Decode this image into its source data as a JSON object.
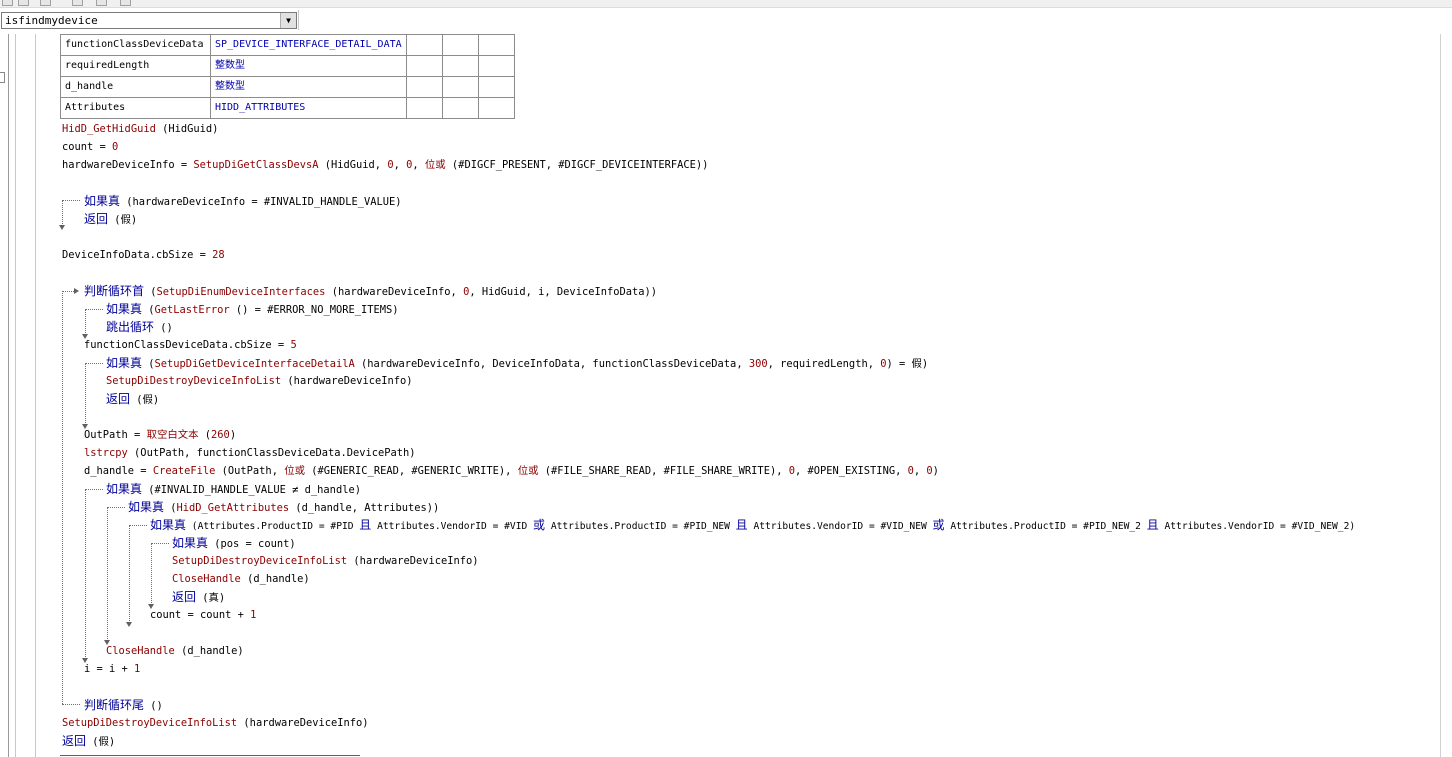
{
  "selector": {
    "value": "isfindmydevice"
  },
  "var_table": [
    {
      "name": "functionClassDeviceData",
      "type": "SP_DEVICE_INTERFACE_DETAIL_DATA"
    },
    {
      "name": "requiredLength",
      "type": "整数型"
    },
    {
      "name": "d_handle",
      "type": "整数型"
    },
    {
      "name": "Attributes",
      "type": "HIDD_ATTRIBUTES"
    }
  ],
  "code": {
    "l1": {
      "fn": "HidD_GetHidGuid",
      "rest": " (HidGuid)"
    },
    "l2": {
      "a": "count = ",
      "n": "0"
    },
    "l3": {
      "a": "hardwareDeviceInfo = ",
      "fn": "SetupDiGetClassDevsA",
      "b": " (HidGuid, ",
      "n1": "0",
      "c": ", ",
      "n2": "0",
      "d": ", ",
      "kw": "位或",
      "e": " (#DIGCF_PRESENT, #DIGCF_DEVICEINTERFACE))"
    },
    "l4": {
      "kw": "如果真",
      "rest": " (hardwareDeviceInfo = #INVALID_HANDLE_VALUE)"
    },
    "l5": {
      "kw": "返回",
      "rest": " (假)"
    },
    "l6": {
      "a": "DeviceInfoData.cbSize = ",
      "n": "28"
    },
    "l7": {
      "kw": "判断循环首",
      "b": " (",
      "fn": "SetupDiEnumDeviceInterfaces",
      "c": " (hardwareDeviceInfo, ",
      "n": "0",
      "d": ", HidGuid, i, DeviceInfoData))"
    },
    "l8": {
      "kw": "如果真",
      "b": " (",
      "fn": "GetLastError",
      "c": " () = #ERROR_NO_MORE_ITEMS)"
    },
    "l9": {
      "kw": "跳出循环",
      "rest": " ()"
    },
    "l10": {
      "a": "functionClassDeviceData.cbSize = ",
      "n": "5"
    },
    "l11": {
      "kw": "如果真",
      "b": " (",
      "fn": "SetupDiGetDeviceInterfaceDetailA",
      "c": " (hardwareDeviceInfo, DeviceInfoData, functionClassDeviceData, ",
      "n": "300",
      "d": ", requiredLength, ",
      "n2": "0",
      "e": ") = 假)"
    },
    "l12": {
      "fn": "SetupDiDestroyDeviceInfoList",
      "rest": " (hardwareDeviceInfo)"
    },
    "l13": {
      "kw": "返回",
      "rest": " (假)"
    },
    "l14": {
      "a": "OutPath = ",
      "kw": "取空白文本",
      "b": " (",
      "n": "260",
      "c": ")"
    },
    "l15": {
      "fn": "lstrcpy",
      "rest": " (OutPath, functionClassDeviceData.DevicePath)"
    },
    "l16": {
      "a": "d_handle = ",
      "fn": "CreateFile",
      "b": " (OutPath, ",
      "kw1": "位或",
      "c": " (#GENERIC_READ, #GENERIC_WRITE), ",
      "kw2": "位或",
      "d": " (#FILE_SHARE_READ, #FILE_SHARE_WRITE), ",
      "n1": "0",
      "e": ", #OPEN_EXISTING, ",
      "n2": "0",
      "f": ", ",
      "n3": "0",
      "g": ")"
    },
    "l17": {
      "kw": "如果真",
      "rest": " (#INVALID_HANDLE_VALUE ≠ d_handle)"
    },
    "l18": {
      "kw": "如果真",
      "b": " (",
      "fn": "HidD_GetAttributes",
      "c": " (d_handle, Attributes))"
    },
    "l19": {
      "kw": "如果真",
      "a": " (Attributes.ProductID = #PID ",
      "k2": "且",
      "b": " Attributes.VendorID = #VID ",
      "k3": "或",
      "c": " Attributes.ProductID = #PID_NEW ",
      "k4": "且",
      "d": " Attributes.VendorID = #VID_NEW ",
      "k5": "或",
      "e": " Attributes.ProductID = #PID_NEW_2 ",
      "k6": "且",
      "f": " Attributes.VendorID = #VID_NEW_2)"
    },
    "l20": {
      "kw": "如果真",
      "rest": " (pos = count)"
    },
    "l21": {
      "fn": "SetupDiDestroyDeviceInfoList",
      "rest": " (hardwareDeviceInfo)"
    },
    "l22": {
      "fn": "CloseHandle",
      "rest": " (d_handle)"
    },
    "l23": {
      "kw": "返回",
      "rest": " (真)"
    },
    "l24": {
      "a": "count = count + ",
      "n": "1"
    },
    "l25": {
      "fn": "CloseHandle",
      "rest": " (d_handle)"
    },
    "l26": {
      "a": "i = i + ",
      "n": "1"
    },
    "l27": {
      "kw": "判断循环尾",
      "rest": " ()"
    },
    "l28": {
      "fn": "SetupDiDestroyDeviceInfoList",
      "rest": " (hardwareDeviceInfo)"
    },
    "l29": {
      "kw": "返回",
      "rest": " (假)"
    }
  }
}
